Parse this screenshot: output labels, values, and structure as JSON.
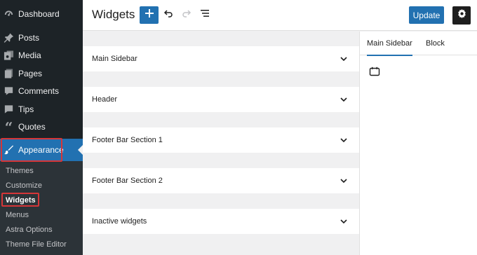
{
  "sidebar": {
    "items": [
      {
        "label": "Dashboard",
        "icon": "dashboard-icon"
      },
      {
        "label": "Posts",
        "icon": "pin-icon"
      },
      {
        "label": "Media",
        "icon": "media-icon"
      },
      {
        "label": "Pages",
        "icon": "pages-icon"
      },
      {
        "label": "Comments",
        "icon": "comment-icon"
      },
      {
        "label": "Tips",
        "icon": "tips-icon"
      },
      {
        "label": "Quotes",
        "icon": "quote-icon"
      },
      {
        "label": "Appearance",
        "icon": "brush-icon"
      }
    ],
    "submenu": [
      {
        "label": "Themes"
      },
      {
        "label": "Customize"
      },
      {
        "label": "Widgets"
      },
      {
        "label": "Menus"
      },
      {
        "label": "Astra Options"
      },
      {
        "label": "Theme File Editor"
      }
    ]
  },
  "header": {
    "title": "Widgets",
    "update_label": "Update"
  },
  "widget_areas": [
    {
      "title": "Main Sidebar"
    },
    {
      "title": "Header"
    },
    {
      "title": "Footer Bar Section 1"
    },
    {
      "title": "Footer Bar Section 2"
    },
    {
      "title": "Inactive widgets"
    }
  ],
  "inspector": {
    "tabs": [
      {
        "label": "Main Sidebar"
      },
      {
        "label": "Block"
      }
    ]
  },
  "colors": {
    "accent": "#2271b1",
    "sidebar_bg": "#1d2327",
    "highlight_border": "#d63638"
  }
}
